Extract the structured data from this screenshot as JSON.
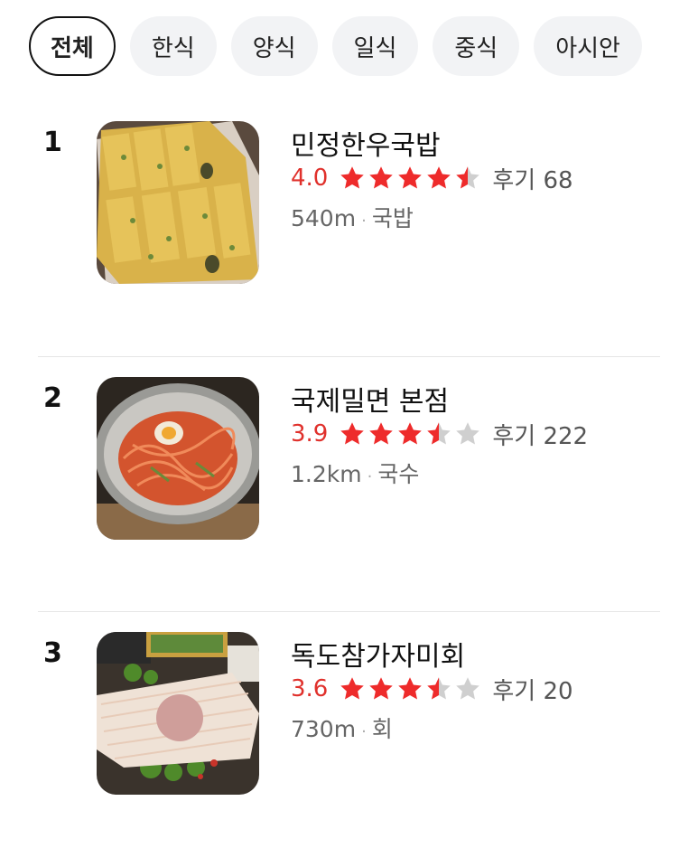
{
  "filters": [
    {
      "label": "전체",
      "active": true
    },
    {
      "label": "한식",
      "active": false
    },
    {
      "label": "양식",
      "active": false
    },
    {
      "label": "일식",
      "active": false
    },
    {
      "label": "중식",
      "active": false
    },
    {
      "label": "아시안",
      "active": false
    }
  ],
  "restaurants": [
    {
      "rank": "1",
      "name": "민정한우국밥",
      "score": "4.0",
      "stars": 4.5,
      "reviews": "후기 68",
      "distance": "540m",
      "category": "국밥",
      "thumbnail": "pancake-photo-icon"
    },
    {
      "rank": "2",
      "name": "국제밀면 본점",
      "score": "3.9",
      "stars": 3.5,
      "reviews": "후기 222",
      "distance": "1.2km",
      "category": "국수",
      "thumbnail": "noodle-bowl-photo-icon"
    },
    {
      "rank": "3",
      "name": "독도참가자미회",
      "score": "3.6",
      "stars": 3.5,
      "reviews": "후기 20",
      "distance": "730m",
      "category": "회",
      "thumbnail": "sashimi-platter-photo-icon"
    }
  ],
  "colors": {
    "star_filled": "#ee2b2b",
    "star_empty": "#cfcfcf",
    "score": "#e0312c"
  }
}
